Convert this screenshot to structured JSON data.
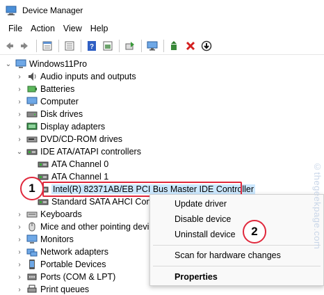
{
  "window": {
    "title": "Device Manager"
  },
  "menu": [
    "File",
    "Action",
    "View",
    "Help"
  ],
  "toolbar": {
    "buttons": [
      "back-icon",
      "forward-icon",
      "properties-icon",
      "help-icon",
      "show-hidden-icon",
      "scan-icon",
      "monitor-icon",
      "update-driver-icon",
      "uninstall-icon",
      "disable-icon"
    ]
  },
  "tree": {
    "root": "Windows11Pro",
    "items": [
      {
        "label": "Audio inputs and outputs",
        "icon": "audio-icon"
      },
      {
        "label": "Batteries",
        "icon": "battery-icon"
      },
      {
        "label": "Computer",
        "icon": "computer-icon"
      },
      {
        "label": "Disk drives",
        "icon": "disk-icon"
      },
      {
        "label": "Display adapters",
        "icon": "display-icon"
      },
      {
        "label": "DVD/CD-ROM drives",
        "icon": "dvd-icon"
      },
      {
        "label": "IDE ATA/ATAPI controllers",
        "icon": "ide-icon"
      },
      {
        "label": "ATA Channel 0",
        "icon": "ide-icon"
      },
      {
        "label": "ATA Channel 1",
        "icon": "ide-icon"
      },
      {
        "label": "Intel(R) 82371AB/EB PCI Bus Master IDE Controller",
        "icon": "ide-icon"
      },
      {
        "label": "Standard SATA AHCI Contr",
        "icon": "ide-icon"
      },
      {
        "label": "Keyboards",
        "icon": "keyboard-icon"
      },
      {
        "label": "Mice and other pointing devi",
        "icon": "mouse-icon"
      },
      {
        "label": "Monitors",
        "icon": "monitor-icon"
      },
      {
        "label": "Network adapters",
        "icon": "network-icon"
      },
      {
        "label": "Portable Devices",
        "icon": "portable-icon"
      },
      {
        "label": "Ports (COM & LPT)",
        "icon": "port-icon"
      },
      {
        "label": "Print queues",
        "icon": "printer-icon"
      }
    ]
  },
  "context_menu": {
    "items": [
      "Update driver",
      "Disable device",
      "Uninstall device",
      "Scan for hardware changes",
      "Properties"
    ]
  },
  "callouts": [
    "1",
    "2"
  ],
  "watermark": "©thegeekpage.com",
  "colors": {
    "highlight": "#e0283c",
    "selection": "#cce8ff"
  }
}
